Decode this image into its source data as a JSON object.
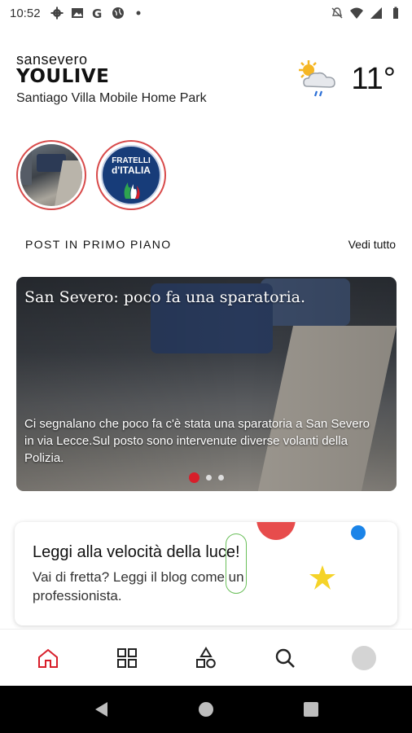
{
  "status_bar": {
    "time": "10:52",
    "left_icons": [
      "settings-icon",
      "photo-icon",
      "google-icon",
      "globe-icon",
      "dot-icon"
    ],
    "right_icons": [
      "mute-icon",
      "wifi-icon",
      "signal-icon",
      "battery-icon"
    ]
  },
  "header": {
    "brand_top": "sansevero",
    "brand_main": "YOULIVE",
    "location": "Santiago Villa Mobile Home Park",
    "weather_icon": "partly-cloudy-rain-icon",
    "temperature": "11°"
  },
  "stories": [
    {
      "name": "street-photo"
    },
    {
      "name": "fratelli-ditalia",
      "logo_text": [
        "FRATELLI",
        "d'ITALIA"
      ]
    }
  ],
  "section": {
    "title": "POST IN PRIMO PIANO",
    "see_all": "Vedi tutto"
  },
  "featured": {
    "title": "San Severo: poco fa una sparatoria.",
    "text": "Ci segnalano che poco fa c'è stata una sparatoria a San Severo in via Lecce.Sul posto sono intervenute diverse volanti della Polizia.",
    "dots_count": 3,
    "active_dot": 0
  },
  "promo": {
    "title": "Leggi alla velocità della luce!",
    "text": "Vai di fretta? Leggi il blog come un professionista."
  },
  "bottom_nav": {
    "items": [
      "home-icon",
      "grid-icon",
      "shapes-icon",
      "search-icon",
      "avatar"
    ],
    "active": "home-icon"
  },
  "colors": {
    "accent": "#d81e2a",
    "story_border": "#d84a4a",
    "promo_red": "#e74c4c",
    "promo_blue": "#1b84e8",
    "promo_yellow": "#f5d328",
    "promo_green": "#6abf5a"
  }
}
